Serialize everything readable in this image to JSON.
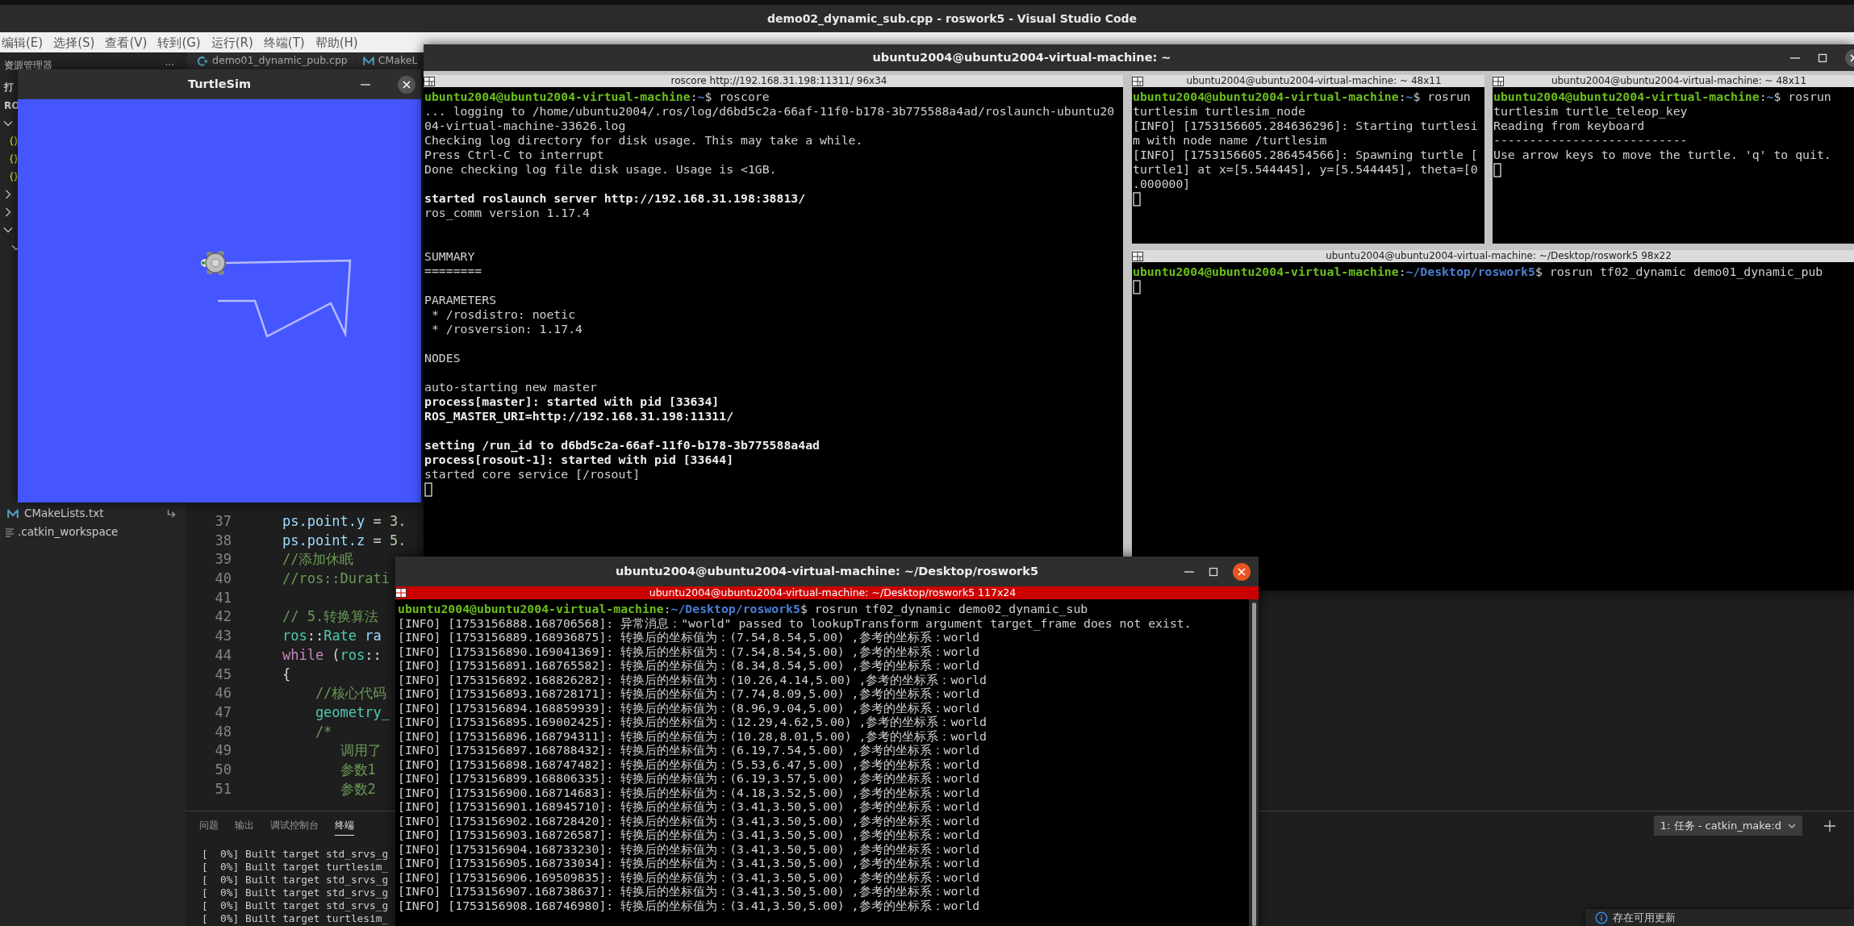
{
  "vscode": {
    "title": "demo02_dynamic_sub.cpp - roswork5 - Visual Studio Code",
    "menu": [
      "编辑(E)",
      "选择(S)",
      "查看(V)",
      "转到(G)",
      "运行(R)",
      "终端(T)",
      "帮助(H)"
    ],
    "sidebar": {
      "title": "资源管理器",
      "more": "···",
      "section_labels": [
        "打",
        "RO"
      ],
      "tree": [
        {
          "kind": "folder",
          "expanded": true,
          "children": [
            {
              "kind": "json"
            },
            {
              "kind": "json"
            },
            {
              "kind": "json"
            }
          ]
        },
        {
          "kind": "folder",
          "expanded": false
        },
        {
          "kind": "folder",
          "expanded": false
        },
        {
          "kind": "folder",
          "expanded": true,
          "children": [
            {
              "kind": "folder",
              "expanded": true
            }
          ]
        }
      ],
      "files": [
        {
          "kind": "cmake",
          "label": "CMakeLists.txt"
        },
        {
          "kind": "text",
          "label": ".catkin_workspace"
        }
      ]
    },
    "tabs": [
      {
        "kind": "cpp",
        "label": "demo01_dynamic_pub.cpp"
      },
      {
        "kind": "cmake",
        "label": "CMakeL"
      }
    ],
    "code": [
      {
        "number": "37",
        "tokens": [
          {
            "t": "    ps.point.y",
            "kind": "var"
          },
          {
            "t": " = ",
            "kind": "op"
          },
          {
            "t": "3.",
            "kind": "num"
          }
        ]
      },
      {
        "number": "38",
        "tokens": [
          {
            "t": "    ps.point.z",
            "kind": "var"
          },
          {
            "t": " = ",
            "kind": "op"
          },
          {
            "t": "5.",
            "kind": "num"
          }
        ]
      },
      {
        "number": "39",
        "tokens": [
          {
            "t": "    //添加休眠",
            "kind": "comment"
          }
        ]
      },
      {
        "number": "40",
        "tokens": [
          {
            "t": "    //ros::Durati",
            "kind": "comment"
          }
        ]
      },
      {
        "number": "41"
      },
      {
        "number": "42",
        "tokens": [
          {
            "t": "    // 5.转换算法",
            "kind": "comment"
          }
        ]
      },
      {
        "number": "43",
        "tokens": [
          {
            "t": "    ros",
            "kind": "type"
          },
          {
            "t": "::",
            "kind": "op"
          },
          {
            "t": "Rate",
            "kind": "type"
          },
          {
            "t": " ra",
            "kind": "var"
          }
        ]
      },
      {
        "number": "44",
        "tokens": [
          {
            "t": "    while",
            "kind": "keyword"
          },
          {
            "t": " (",
            "kind": "op"
          },
          {
            "t": "ros",
            "kind": "type"
          },
          {
            "t": "::",
            "kind": "op"
          }
        ]
      },
      {
        "number": "45",
        "tokens": [
          {
            "t": "    {",
            "kind": "op"
          }
        ]
      },
      {
        "number": "46",
        "tokens": [
          {
            "t": "        //核心代码",
            "kind": "comment"
          }
        ]
      },
      {
        "number": "47",
        "tokens": [
          {
            "t": "        geometry_",
            "kind": "type"
          }
        ]
      },
      {
        "number": "48",
        "tokens": [
          {
            "t": "        /*",
            "kind": "comment"
          }
        ]
      },
      {
        "number": "49",
        "tokens": [
          {
            "t": "           调用了",
            "kind": "comment"
          }
        ]
      },
      {
        "number": "50",
        "tokens": [
          {
            "t": "           参数1",
            "kind": "comment"
          }
        ]
      },
      {
        "number": "51",
        "tokens": [
          {
            "t": "           参数2",
            "kind": "comment"
          }
        ]
      }
    ],
    "panel": {
      "tabs": [
        {
          "label": "问题",
          "selected": false
        },
        {
          "label": "输出",
          "selected": false
        },
        {
          "label": "调试控制台",
          "selected": false
        },
        {
          "label": "终端",
          "selected": true
        }
      ],
      "terminal_select": "1: 任务 - catkin_make:d",
      "terminal_lines": [
        "[  0%] Built target std_srvs_g",
        "[  0%] Built target turtlesim_",
        "[  0%] Built target std_srvs_g",
        "[  0%] Built target std_srvs_g",
        "[  0%] Built target std_srvs_g",
        "[  0%] Built target turtlesim_"
      ]
    },
    "notification": "存在可用更新"
  },
  "turtlesim": {
    "title": "TurtleSim"
  },
  "terminator": {
    "title": "ubuntu2004@ubuntu2004-virtual-machine: ~",
    "panes": [
      {
        "title": "roscore http://192.168.31.198:11311/ 96x34",
        "lines": [
          {
            "kind": "prompt",
            "user": "ubuntu2004@ubuntu2004-virtual-machine",
            "sep": ":",
            "path": "~",
            "command": "$ roscore"
          },
          {
            "kind": "text",
            "text": "... logging to /home/ubuntu2004/.ros/log/d6bd5c2a-66af-11f0-b178-3b775588a4ad/roslaunch-ubuntu20"
          },
          {
            "kind": "text",
            "text": "04-virtual-machine-33626.log"
          },
          {
            "kind": "text",
            "text": "Checking log directory for disk usage. This may take a while."
          },
          {
            "kind": "text",
            "text": "Press Ctrl-C to interrupt"
          },
          {
            "kind": "text",
            "text": "Done checking log file disk usage. Usage is <1GB."
          },
          {
            "kind": "blank"
          },
          {
            "kind": "bold",
            "text": "started roslaunch server http://192.168.31.198:38813/"
          },
          {
            "kind": "text",
            "text": "ros_comm version 1.17.4"
          },
          {
            "kind": "blank"
          },
          {
            "kind": "blank"
          },
          {
            "kind": "text",
            "text": "SUMMARY"
          },
          {
            "kind": "text",
            "text": "========"
          },
          {
            "kind": "blank"
          },
          {
            "kind": "text",
            "text": "PARAMETERS"
          },
          {
            "kind": "text",
            "text": " * /rosdistro: noetic"
          },
          {
            "kind": "text",
            "text": " * /rosversion: 1.17.4"
          },
          {
            "kind": "blank"
          },
          {
            "kind": "text",
            "text": "NODES"
          },
          {
            "kind": "blank"
          },
          {
            "kind": "text",
            "text": "auto-starting new master"
          },
          {
            "kind": "bold",
            "text": "process[master]: started with pid [33634]"
          },
          {
            "kind": "bold",
            "text": "ROS_MASTER_URI=http://192.168.31.198:11311/"
          },
          {
            "kind": "blank"
          },
          {
            "kind": "bold",
            "text": "setting /run_id to d6bd5c2a-66af-11f0-b178-3b775588a4ad"
          },
          {
            "kind": "bold",
            "text": "process[rosout-1]: started with pid [33644]"
          },
          {
            "kind": "text",
            "text": "started core service [/rosout]"
          },
          {
            "kind": "cursor"
          }
        ]
      },
      {
        "title": "ubuntu2004@ubuntu2004-virtual-machine: ~ 48x11",
        "lines": [
          {
            "kind": "prompt",
            "user": "ubuntu2004@ubuntu2004-virtual-machine",
            "sep": ":",
            "path": "~",
            "command": "$ rosrun"
          },
          {
            "kind": "text",
            "text": "turtlesim turtlesim_node"
          },
          {
            "kind": "text",
            "text": "[INFO] [1753156605.284636296]: Starting turtlesi"
          },
          {
            "kind": "text",
            "text": "m with node name /turtlesim"
          },
          {
            "kind": "text",
            "text": "[INFO] [1753156605.286454566]: Spawning turtle ["
          },
          {
            "kind": "text",
            "text": "turtle1] at x=[5.544445], y=[5.544445], theta=[0"
          },
          {
            "kind": "text",
            "text": ".000000]"
          },
          {
            "kind": "cursor"
          }
        ]
      },
      {
        "title": "ubuntu2004@ubuntu2004-virtual-machine: ~ 48x11",
        "lines": [
          {
            "kind": "prompt",
            "user": "ubuntu2004@ubuntu2004-virtual-machine",
            "sep": ":",
            "path": "~",
            "command": "$ rosrun"
          },
          {
            "kind": "text",
            "text": "turtlesim turtle_teleop_key"
          },
          {
            "kind": "text",
            "text": "Reading from keyboard"
          },
          {
            "kind": "text",
            "text": "---------------------------"
          },
          {
            "kind": "text",
            "text": "Use arrow keys to move the turtle. 'q' to quit."
          },
          {
            "kind": "cursor"
          }
        ]
      },
      {
        "title": "ubuntu2004@ubuntu2004-virtual-machine: ~/Desktop/roswork5 98x22",
        "lines": [
          {
            "kind": "prompt",
            "user": "ubuntu2004@ubuntu2004-virtual-machine",
            "sep": ":",
            "path": "~/Desktop/roswork5",
            "command": "$ rosrun tf02_dynamic demo01_dynamic_pub"
          },
          {
            "kind": "cursor"
          }
        ]
      }
    ]
  },
  "sub_terminal": {
    "title": "ubuntu2004@ubuntu2004-virtual-machine: ~/Desktop/roswork5",
    "tab_title": "ubuntu2004@ubuntu2004-virtual-machine: ~/Desktop/roswork5 117x24",
    "lines": [
      {
        "kind": "prompt",
        "user": "ubuntu2004@ubuntu2004-virtual-machine",
        "sep": ":",
        "path": "~/Desktop/roswork5",
        "command": "$ rosrun tf02_dynamic demo02_dynamic_sub"
      },
      {
        "kind": "text",
        "text": "[INFO] [1753156888.168706568]: 异常消息：\"world\" passed to lookupTransform argument target_frame does not exist."
      },
      {
        "kind": "text",
        "text": "[INFO] [1753156889.168936875]: 转换后的坐标值为：(7.54,8.54,5.00) ,参考的坐标系：world"
      },
      {
        "kind": "text",
        "text": "[INFO] [1753156890.169041369]: 转换后的坐标值为：(7.54,8.54,5.00) ,参考的坐标系：world"
      },
      {
        "kind": "text",
        "text": "[INFO] [1753156891.168765582]: 转换后的坐标值为：(8.34,8.54,5.00) ,参考的坐标系：world"
      },
      {
        "kind": "text",
        "text": "[INFO] [1753156892.168826282]: 转换后的坐标值为：(10.26,4.14,5.00) ,参考的坐标系：world"
      },
      {
        "kind": "text",
        "text": "[INFO] [1753156893.168728171]: 转换后的坐标值为：(7.74,8.09,5.00) ,参考的坐标系：world"
      },
      {
        "kind": "text",
        "text": "[INFO] [1753156894.168859939]: 转换后的坐标值为：(8.96,9.04,5.00) ,参考的坐标系：world"
      },
      {
        "kind": "text",
        "text": "[INFO] [1753156895.169002425]: 转换后的坐标值为：(12.29,4.62,5.00) ,参考的坐标系：world"
      },
      {
        "kind": "text",
        "text": "[INFO] [1753156896.168794311]: 转换后的坐标值为：(10.28,8.01,5.00) ,参考的坐标系：world"
      },
      {
        "kind": "text",
        "text": "[INFO] [1753156897.168788432]: 转换后的坐标值为：(6.19,7.54,5.00) ,参考的坐标系：world"
      },
      {
        "kind": "text",
        "text": "[INFO] [1753156898.168747482]: 转换后的坐标值为：(5.53,6.47,5.00) ,参考的坐标系：world"
      },
      {
        "kind": "text",
        "text": "[INFO] [1753156899.168806335]: 转换后的坐标值为：(6.19,3.57,5.00) ,参考的坐标系：world"
      },
      {
        "kind": "text",
        "text": "[INFO] [1753156900.168714683]: 转换后的坐标值为：(4.18,3.52,5.00) ,参考的坐标系：world"
      },
      {
        "kind": "text",
        "text": "[INFO] [1753156901.168945710]: 转换后的坐标值为：(3.41,3.50,5.00) ,参考的坐标系：world"
      },
      {
        "kind": "text",
        "text": "[INFO] [1753156902.168728420]: 转换后的坐标值为：(3.41,3.50,5.00) ,参考的坐标系：world"
      },
      {
        "kind": "text",
        "text": "[INFO] [1753156903.168726587]: 转换后的坐标值为：(3.41,3.50,5.00) ,参考的坐标系：world"
      },
      {
        "kind": "text",
        "text": "[INFO] [1753156904.168733230]: 转换后的坐标值为：(3.41,3.50,5.00) ,参考的坐标系：world"
      },
      {
        "kind": "text",
        "text": "[INFO] [1753156905.168733034]: 转换后的坐标值为：(3.41,3.50,5.00) ,参考的坐标系：world"
      },
      {
        "kind": "text",
        "text": "[INFO] [1753156906.169509835]: 转换后的坐标值为：(3.41,3.50,5.00) ,参考的坐标系：world"
      },
      {
        "kind": "text",
        "text": "[INFO] [1753156907.168738637]: 转换后的坐标值为：(3.41,3.50,5.00) ,参考的坐标系：world"
      },
      {
        "kind": "text",
        "text": "[INFO] [1753156908.168746980]: 转换后的坐标值为：(3.41,3.50,5.00) ,参考的坐标系：world"
      }
    ]
  }
}
